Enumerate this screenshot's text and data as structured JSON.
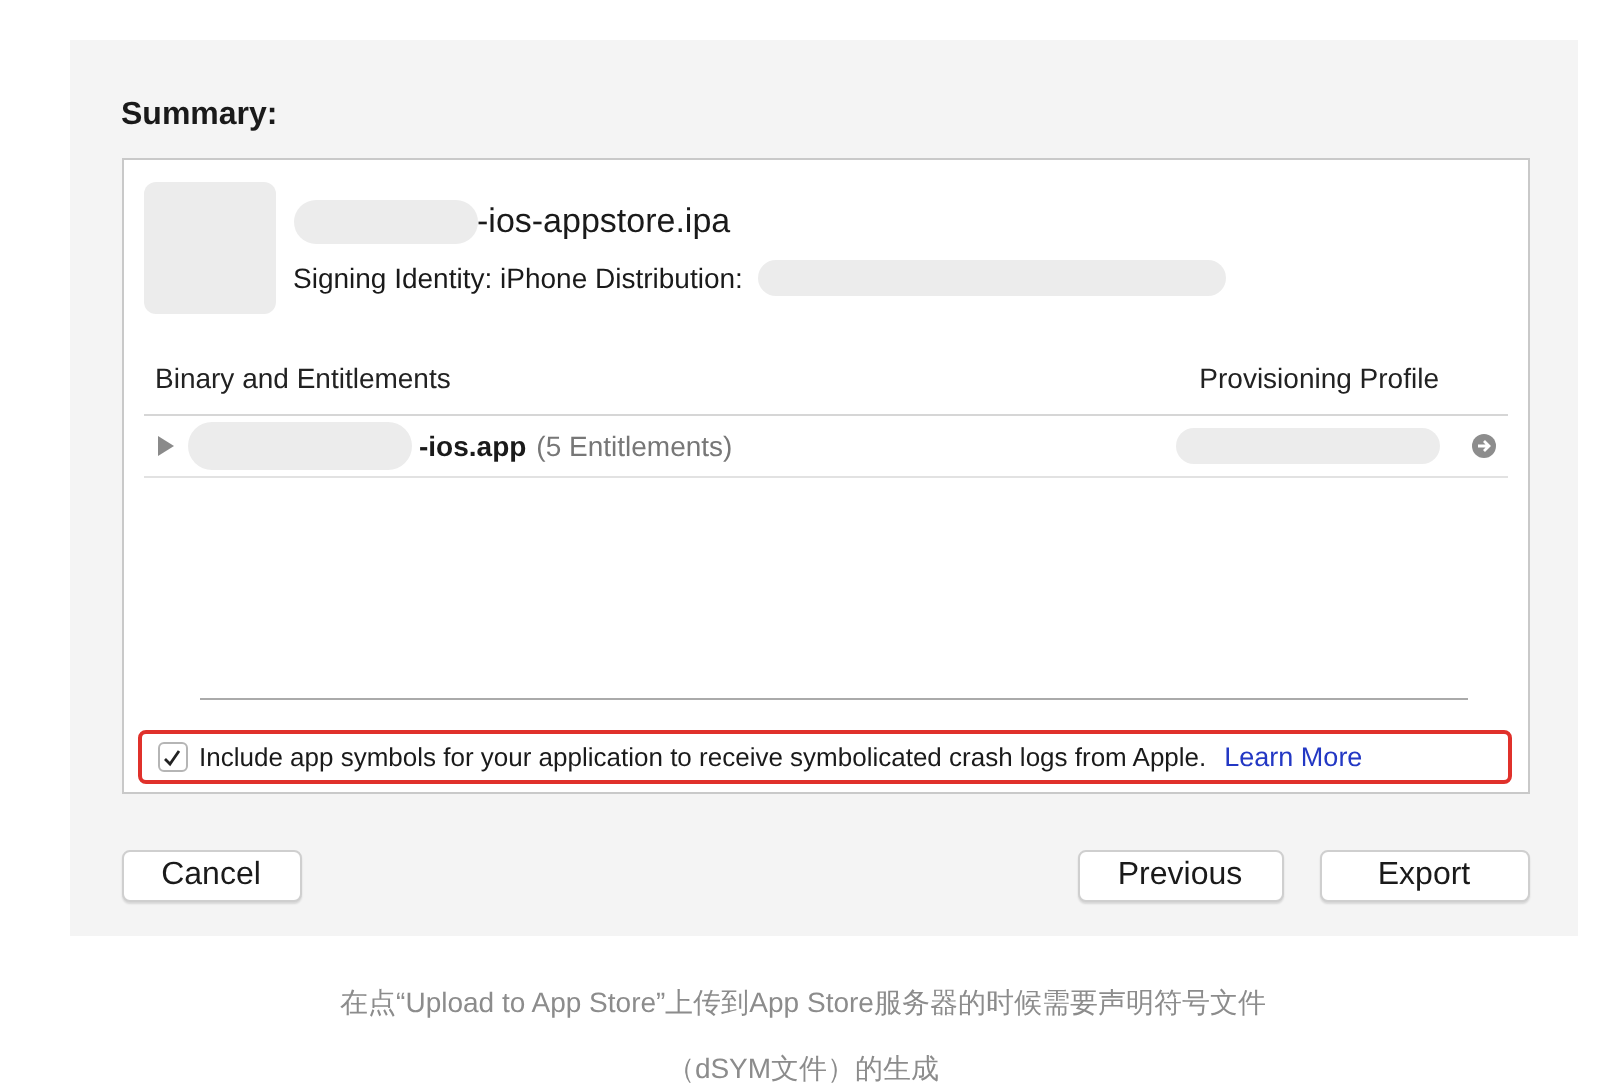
{
  "dialog": {
    "title": "Summary:",
    "archive": {
      "name": "-ios-appstore.ipa",
      "signing_identity": "Signing Identity: iPhone Distribution:"
    },
    "table": {
      "columns": [
        "Binary and Entitlements",
        "Provisioning Profile"
      ],
      "rows": [
        {
          "name": "-ios.app",
          "detail": "(5 Entitlements)",
          "expanded": false
        }
      ]
    },
    "symbols_option": {
      "label": "Include app symbols for your application to receive symbolicated crash logs from Apple.",
      "link": "Learn More",
      "checked": true,
      "highlighted": true
    },
    "buttons_left": [
      "Cancel"
    ],
    "buttons_right": [
      "Previous",
      "Export"
    ]
  },
  "caption": [
    "在点“Upload to App Store”上传到App Store服务器的时候需要声明符号文件",
    "（dSYM文件）的生成"
  ]
}
